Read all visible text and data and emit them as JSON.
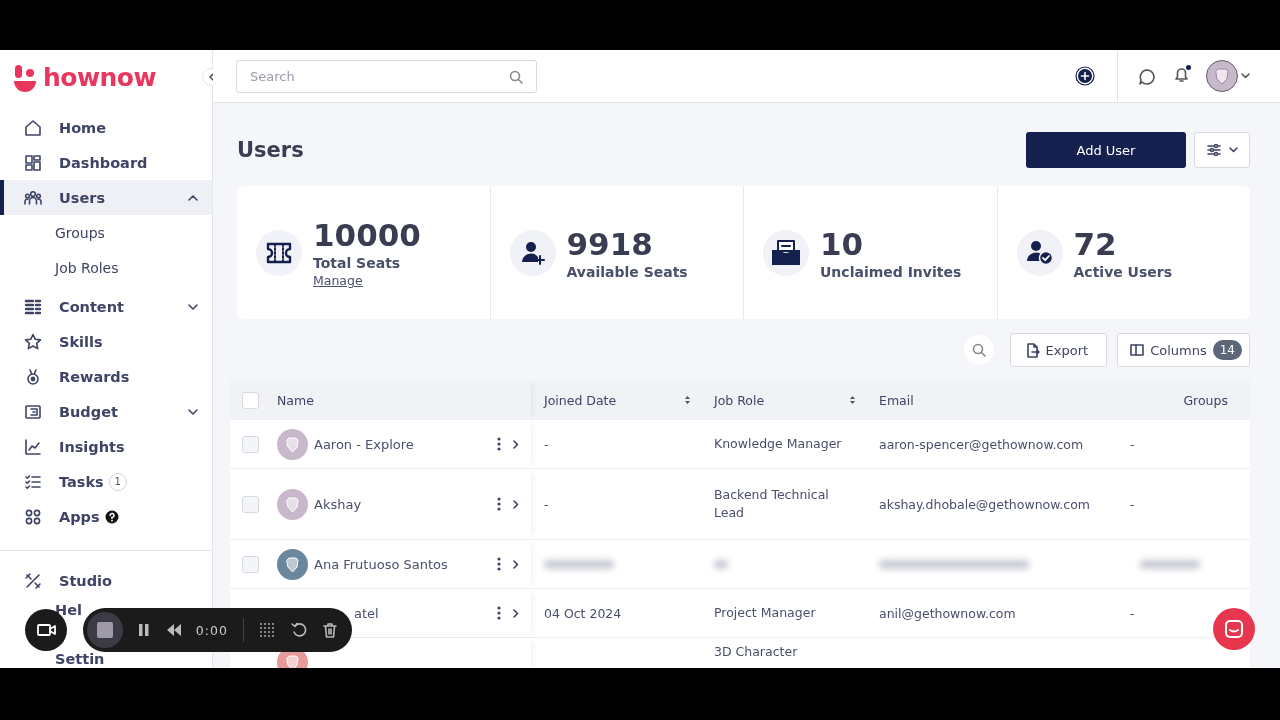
{
  "brand": {
    "name": "hownow"
  },
  "sidebar": {
    "items": [
      {
        "label": "Home",
        "selected": false
      },
      {
        "label": "Dashboard",
        "selected": false
      },
      {
        "label": "Users",
        "selected": true,
        "expanded": true,
        "children": [
          {
            "label": "Groups",
            "selected": false
          },
          {
            "label": "Job Roles",
            "selected": false
          }
        ]
      },
      {
        "label": "Content",
        "selected": false,
        "expanded": false
      },
      {
        "label": "Skills",
        "selected": false
      },
      {
        "label": "Rewards",
        "selected": false
      },
      {
        "label": "Budget",
        "selected": false,
        "expanded": false
      },
      {
        "label": "Insights",
        "selected": false
      },
      {
        "label": "Tasks",
        "selected": false,
        "badge": "1"
      },
      {
        "label": "Apps",
        "selected": false,
        "help": true
      }
    ],
    "footer_items": [
      {
        "label": "Studio"
      },
      {
        "label": "Hel"
      },
      {
        "label": "Settin"
      }
    ]
  },
  "topbar": {
    "search": {
      "placeholder": "Search"
    },
    "notification_dot": true
  },
  "page": {
    "title": "Users",
    "add_button": "Add User"
  },
  "stats": [
    {
      "kind": "ticket",
      "value": "10000",
      "label": "Total Seats",
      "link": "Manage"
    },
    {
      "kind": "user-plus",
      "value": "9918",
      "label": "Available Seats"
    },
    {
      "kind": "inbox",
      "value": "10",
      "label": "Unclaimed Invites"
    },
    {
      "kind": "user-check",
      "value": "72",
      "label": "Active Users"
    }
  ],
  "toolbar": {
    "export": "Export",
    "columns": "Columns",
    "columns_count": "14"
  },
  "table": {
    "select_all_checked": false,
    "columns": [
      {
        "label": "Name",
        "sortable": false
      },
      {
        "label": "Joined Date",
        "sortable": true
      },
      {
        "label": "Job Role",
        "sortable": true
      },
      {
        "label": "Email",
        "sortable": false
      },
      {
        "label": "Groups",
        "sortable": false
      }
    ],
    "rows": [
      {
        "kind": "row",
        "checked": false,
        "name": "Aaron - Explore",
        "joined": "-",
        "role": "Knowledge Manager",
        "email": "aaron-spencer@gethownow.com",
        "groups": "-",
        "color": "#c9b8cc"
      },
      {
        "kind": "row",
        "checked": false,
        "name": "Akshay",
        "joined": "-",
        "role": "Backend Technical Lead",
        "email": "akshay.dhobale@gethownow.com",
        "groups": "-",
        "color": "#c9b8cc"
      },
      {
        "kind": "blurred",
        "checked": false,
        "name": "Ana Frutuoso Santos",
        "color": "#6b879e"
      },
      {
        "kind": "covered",
        "name": "atel",
        "joined": "04 Oct 2024",
        "role": "Project Manager",
        "email": "anil@gethownow.com",
        "groups": "-"
      },
      {
        "kind": "partial",
        "role": "3D Character",
        "color": "#e89a9a"
      }
    ]
  },
  "recorder": {
    "time": "0:00"
  }
}
